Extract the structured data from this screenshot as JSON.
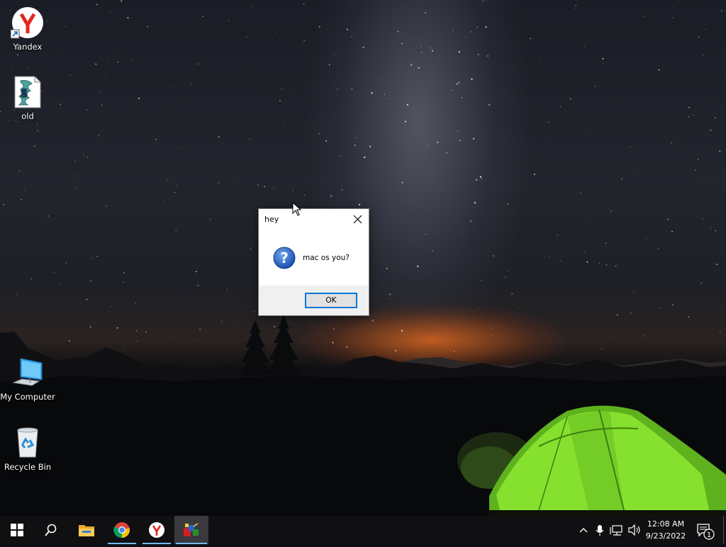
{
  "desktop": {
    "icons": [
      {
        "label": "Yandex"
      },
      {
        "label": "old"
      },
      {
        "label": "My Computer"
      },
      {
        "label": "Recycle Bin"
      }
    ]
  },
  "dialog": {
    "title": "hey",
    "message": "mac os you?",
    "ok_label": "OK",
    "icon": "question-icon"
  },
  "taskbar": {
    "start": "windows-start-icon",
    "search": "search-icon",
    "pinned": [
      "file-explorer-icon",
      "chrome-icon",
      "yandex-icon",
      "running-app-icon"
    ],
    "tray": {
      "time": "12:08 AM",
      "date": "9/23/2022",
      "notification_count": "1"
    }
  },
  "colors": {
    "accent": "#0078d7",
    "taskbar": "#101012",
    "tent": "#7fd82a"
  }
}
